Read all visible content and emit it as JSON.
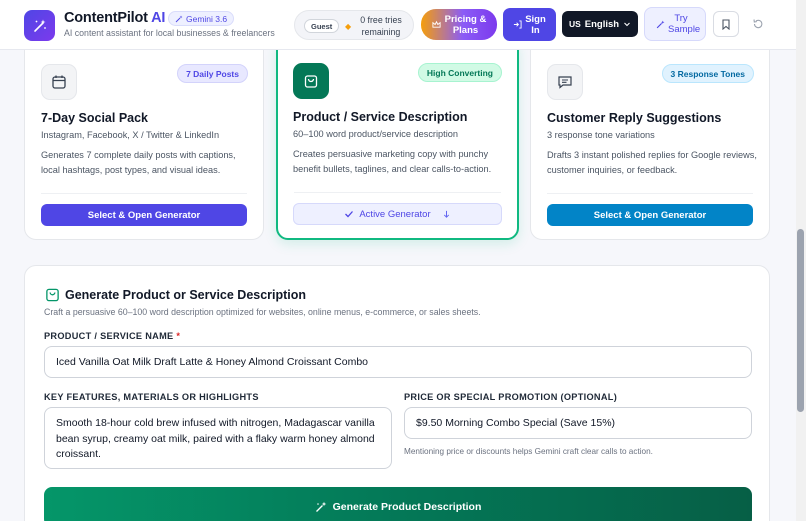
{
  "header": {
    "brand_name": "ContentPilot",
    "brand_suffix": "AI",
    "model_badge": "Gemini 3.6",
    "tagline": "AI content assistant for local businesses & freelancers",
    "guest_badge": "Guest",
    "usage_text": "0 free tries remaining",
    "pricing_label": "Pricing & Plans",
    "signin_label": "Sign In",
    "language_flag": "US",
    "language_label": "English",
    "try_sample_label": "Try Sample",
    "icons": [
      "wand-icon",
      "sparkle-icon",
      "sign-in-icon",
      "chevron-down-icon",
      "bookmark-icon",
      "history-icon"
    ]
  },
  "cards": [
    {
      "badge": "7 Daily Posts",
      "title": "7-Day Social Pack",
      "subtitle": "Instagram, Facebook, X / Twitter & LinkedIn",
      "description": "Generates 7 complete daily posts with captions, local hashtags, post types, and visual ideas.",
      "button": "Select & Open Generator",
      "icon": "calendar-icon",
      "accent": "#4f46e5"
    },
    {
      "badge": "High Converting",
      "title": "Product / Service Description",
      "subtitle": "60–100 word product/service description",
      "description": "Creates persuasive marketing copy with punchy benefit bullets, taglines, and clear calls-to-action.",
      "button": "Active Generator",
      "icon": "shopping-bag-icon",
      "accent": "#10b981"
    },
    {
      "badge": "3 Response Tones",
      "title": "Customer Reply Suggestions",
      "subtitle": "3 response tone variations",
      "description": "Drafts 3 instant polished replies for Google reviews, customer inquiries, or feedback.",
      "button": "Select & Open Generator",
      "icon": "message-icon",
      "accent": "#0284c7"
    }
  ],
  "generator": {
    "title": "Generate Product or Service Description",
    "subtitle": "Craft a persuasive 60–100 word description optimized for websites, online menus, e-commerce, or sales sheets.",
    "name_label": "PRODUCT / SERVICE NAME",
    "name_required": "*",
    "name_value": "Iced Vanilla Oat Milk Draft Latte & Honey Almond Croissant Combo",
    "features_label": "KEY FEATURES, MATERIALS OR HIGHLIGHTS",
    "features_value": "Smooth 18-hour cold brew infused with nitrogen, Madagascar vanilla bean syrup, creamy oat milk, paired with a flaky warm honey almond croissant.",
    "price_label": "PRICE OR SPECIAL PROMOTION (OPTIONAL)",
    "price_value": "$9.50 Morning Combo Special (Save 15%)",
    "price_hint": "Mentioning price or discounts helps Gemini craft clear calls to action.",
    "generate_button": "Generate Product Description"
  },
  "colors": {
    "primary": "#4f46e5",
    "success": "#10b981",
    "info": "#0284c7",
    "dark": "#111827"
  }
}
